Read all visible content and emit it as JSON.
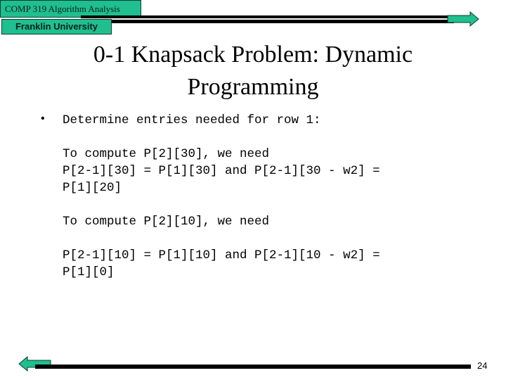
{
  "header": {
    "course": "COMP 319 Algorithm Analysis",
    "university": "Franklin University"
  },
  "title": {
    "line1": "0-1 Knapsack Problem: Dynamic",
    "line2": "Programming"
  },
  "content": {
    "bullet_symbol": "•",
    "bullet_text": "Determine entries needed for row 1:",
    "block1": {
      "line1": "To compute P[2][30], we need",
      "line2": "P[2-1][30] = P[1][30] and P[2-1][30 - w2] =",
      "line3": "P[1][20]"
    },
    "block2": {
      "line1": "To compute P[2][10], we need",
      "line2": "P[2-1][10] = P[1][10] and P[2-1][10 - w2] =",
      "line3": "P[1][0]"
    }
  },
  "footer": {
    "page_number": "24"
  },
  "colors": {
    "accent": "#1fbf8f",
    "accent_border": "#0b3d2c"
  },
  "icons": {
    "next": "arrow-right-icon",
    "prev": "arrow-left-icon"
  }
}
